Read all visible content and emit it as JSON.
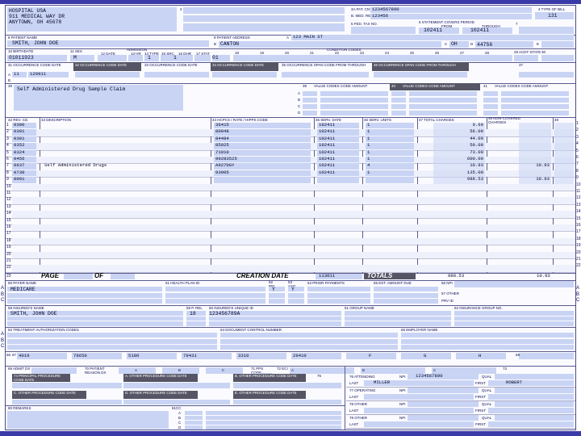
{
  "provider": {
    "name": "HOSPITAL USA",
    "street": "911 MEDICAL WAY DR",
    "city_state_zip": "ANYTOWN, OH 45678"
  },
  "header": {
    "box2_label": "2",
    "pat_cntl_label": "3a PAT. CNTL #",
    "pat_cntl_value": "1234567890",
    "med_rec_label": "b. MED. REC. #",
    "med_rec_value": "123456",
    "type_bill_label": "4 TYPE OF BILL",
    "type_bill_value": "131",
    "fed_tax_label": "5 FED. TAX NO.",
    "statement_label": "6 STATEMENT COVERS PERIOD",
    "from_label": "FROM",
    "through_label": "THROUGH",
    "from_value": "102411",
    "through_value": "102411",
    "box7_label": "7"
  },
  "patient": {
    "name_label": "8 PATIENT NAME",
    "name_prefix": "a",
    "name_value": "SMITH, JOHN DOE",
    "address_label": "9 PATIENT ADDRESS",
    "address_prefix": "a",
    "street_value": "123 MAIN ST",
    "city_prefix": "b",
    "city_value": "CANTON",
    "state_prefix": "c",
    "state_value": "OH",
    "zip_prefix": "d",
    "zip_value": "44756",
    "e_prefix": "e",
    "birthdate_label": "10 BIRTHDATE",
    "birthdate_value": "01011923",
    "sex_label": "11 SEX",
    "sex_value": "M",
    "admission_label": "ADMISSION",
    "date_label": "12 DATE",
    "hr_label": "13 HR",
    "type_label": "14 TYPE",
    "src_label": "15 SRC",
    "dhr_label": "16 DHR",
    "stat_label": "17 STAT",
    "type_value": "1",
    "src_value": "1",
    "stat_value": "01",
    "condition_label": "CONDITION CODES",
    "condition_numbers": [
      "18",
      "19",
      "20",
      "21",
      "22",
      "23",
      "24",
      "25",
      "26",
      "27",
      "28"
    ],
    "acdt_label": "29 ACDT STATE",
    "box30_label": "30"
  },
  "occurrence": {
    "headers": [
      "31 OCCURRENCE CODE DATE",
      "32 OCCURRENCE CODE DATE",
      "33 OCCURRENCE CODE DATE",
      "34 OCCURRENCE CODE DATE",
      "35 OCCURRENCE SPAN CODE FROM THROUGH",
      "36 OCCURRENCE SPAN CODE FROM THROUGH",
      "37"
    ],
    "row_prefix": "a",
    "code_value": "11",
    "date_value": "120911",
    "row_b_prefix": "b"
  },
  "remarks_block": {
    "box38_label": "38",
    "note": "Self Administered Drug Sample Claim",
    "value_codes_label": "VALUE CODES CODE AMOUNT",
    "value_code_numbers": [
      "39",
      "40",
      "41"
    ],
    "value_code_rows": [
      "a",
      "b",
      "c",
      "d"
    ]
  },
  "service_lines": {
    "headers": {
      "rev_cd": "42 REV. CD.",
      "description": "43 DESCRIPTION",
      "hcpcs": "44 HCPCS / RATE / HIPPS CODE",
      "serv_date": "45 SERV. DATE",
      "serv_units": "46 SERV. UNITS",
      "total_charges": "47 TOTAL CHARGES",
      "non_covered": "48 NON-COVERED CHARGES",
      "box49": "49"
    },
    "rows": [
      {
        "n": "1",
        "rev": "0300",
        "desc": "",
        "hcpcs": "36415",
        "date": "102411",
        "units": "1",
        "total": "9.60",
        "noncov": ""
      },
      {
        "n": "2",
        "rev": "0301",
        "desc": "",
        "hcpcs": "80048",
        "date": "102411",
        "units": "1",
        "total": "56.00",
        "noncov": ""
      },
      {
        "n": "3",
        "rev": "0301",
        "desc": "",
        "hcpcs": "84484",
        "date": "102411",
        "units": "1",
        "total": "44.00",
        "noncov": ""
      },
      {
        "n": "4",
        "rev": "0352",
        "desc": "",
        "hcpcs": "85025",
        "date": "102411",
        "units": "1",
        "total": "50.00",
        "noncov": ""
      },
      {
        "n": "5",
        "rev": "0324",
        "desc": "",
        "hcpcs": "71010",
        "date": "102411",
        "units": "1",
        "total": "73.00",
        "noncov": ""
      },
      {
        "n": "6",
        "rev": "0456",
        "desc": "",
        "hcpcs": "99283525",
        "date": "102411",
        "units": "1",
        "total": "600.00",
        "noncov": ""
      },
      {
        "n": "7",
        "rev": "0637",
        "desc": "Self Administered Drugs",
        "hcpcs": "A9270GY",
        "date": "102411",
        "units": "4",
        "total": "10.93",
        "noncov": "10.93"
      },
      {
        "n": "8",
        "rev": "0730",
        "desc": "",
        "hcpcs": "93005",
        "date": "102411",
        "units": "1",
        "total": "135.00",
        "noncov": ""
      },
      {
        "n": "9",
        "rev": "0001",
        "desc": "",
        "hcpcs": "",
        "date": "",
        "units": "",
        "total": "988.53",
        "noncov": "10.93"
      }
    ],
    "row_count": 22,
    "footer": {
      "page_label": "PAGE",
      "of_label": "OF",
      "creation_label": "CREATION DATE",
      "creation_value": "113011",
      "totals_label": "TOTALS",
      "total_value": "988.53",
      "noncov_value": "10.93",
      "row23": "23"
    }
  },
  "payer": {
    "payer_label": "50 PAYER NAME",
    "health_plan_label": "51 HEALTH PLAN ID",
    "rel_info_label": "52 REL. INFO",
    "asg_ben_label": "53 ASG. BEN.",
    "prior_payments_label": "54 PRIOR PAYMENTS",
    "est_amount_label": "55 EST. AMOUNT DUE",
    "npi_label": "56 NPI",
    "other_label": "57 OTHER",
    "prv_id_label": "PRV ID",
    "payer_value": "MEDICARE",
    "rel_value": "Y",
    "asg_value": "Y",
    "rows": [
      "A",
      "B",
      "C"
    ]
  },
  "insured": {
    "name_label": "58 INSURED'S NAME",
    "rel_label": "59 P. REL",
    "unique_id_label": "60 INSURED'S UNIQUE ID",
    "group_name_label": "61 GROUP NAME",
    "group_no_label": "62 INSURANCE GROUP NO.",
    "name_value": "SMITH, JOHN DOE",
    "rel_value": "18",
    "unique_id_value": "123456789A"
  },
  "authorization": {
    "treatment_label": "63 TREATMENT AUTHORIZATION CODES",
    "document_label": "64 DOCUMENT CONTROL NUMBER",
    "employer_label": "65 EMPLOYER NAME",
    "rows": [
      "A",
      "B",
      "C"
    ]
  },
  "diagnosis": {
    "box66": "66",
    "box67": "67",
    "codes": [
      "4019",
      "78650",
      "5180",
      "79431",
      "3310",
      "29410"
    ],
    "letters": [
      "F",
      "G",
      "H"
    ],
    "box68": "68"
  },
  "procedures": {
    "admit_dx_label": "69 ADMIT DX",
    "patient_reason_label": "70 PATIENT REASON DX",
    "reason_letters": [
      "a",
      "b",
      "c"
    ],
    "pps_label": "71 PPS CODE",
    "eci_label": "72 ECI",
    "eci_letters": [
      "a",
      "b",
      "c"
    ],
    "box73": "73",
    "principal_label": "74 PRINCIPAL PROCEDURE CODE DATE",
    "other_proc_labels": [
      "a. OTHER PROCEDURE CODE DATE",
      "b. OTHER PROCEDURE CODE DATE",
      "c. OTHER PROCEDURE CODE DATE",
      "d. OTHER PROCEDURE CODE DATE",
      "e. OTHER PROCEDURE CODE DATE"
    ],
    "box75": "75"
  },
  "physicians": {
    "attending_label": "76 ATTENDING",
    "npi_label": "NPI",
    "npi_value": "1234567890",
    "qual_label": "QUAL",
    "last_label": "LAST",
    "first_label": "FIRST",
    "last_value": "MILLER",
    "first_value": "ROBERT",
    "operating_label": "77 OPERATING",
    "other78_label": "78 OTHER",
    "other79_label": "79 OTHER"
  },
  "remarks": {
    "remarks_label": "80 REMARKS",
    "cc_label": "81CC",
    "cc_rows": [
      "a",
      "b",
      "c",
      "d"
    ]
  },
  "colors": {
    "field": "#c9d4f4",
    "ink": "#0a0a40",
    "frame": "#3a3aa8",
    "dark_header": "#555566"
  }
}
